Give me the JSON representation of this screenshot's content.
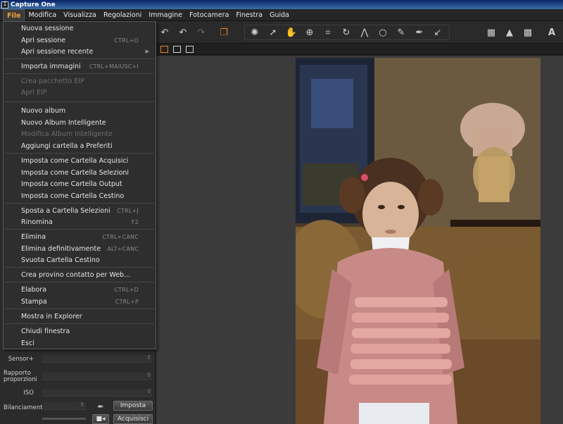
{
  "window": {
    "title": "Capture One"
  },
  "menubar": [
    "File",
    "Modifica",
    "Visualizza",
    "Regolazioni",
    "Immagine",
    "Fotocamera",
    "Finestra",
    "Guida"
  ],
  "file_menu": [
    {
      "label": "Nuova sessione",
      "shortcut": "",
      "enabled": true
    },
    {
      "label": "Apri sessione",
      "shortcut": "CTRL+O",
      "enabled": true
    },
    {
      "label": "Apri sessione recente",
      "shortcut": "",
      "enabled": true,
      "submenu": true
    },
    {
      "label": "Importa immagini",
      "shortcut": "CTRL+MAIUSC+I",
      "enabled": true
    },
    {
      "label": "Crea pacchetto EIP",
      "shortcut": "",
      "enabled": false
    },
    {
      "label": "Apri EIP",
      "shortcut": "",
      "enabled": false
    },
    {
      "label": "Nuovo album",
      "shortcut": "",
      "enabled": true
    },
    {
      "label": "Nuovo Album Intelligente",
      "shortcut": "",
      "enabled": true
    },
    {
      "label": "Modifica Album Intelligente",
      "shortcut": "",
      "enabled": false
    },
    {
      "label": "Aggiungi cartella a Preferiti",
      "shortcut": "",
      "enabled": true
    },
    {
      "label": "Imposta come Cartella Acquisici",
      "shortcut": "",
      "enabled": true
    },
    {
      "label": "Imposta come Cartella Selezioni",
      "shortcut": "",
      "enabled": true
    },
    {
      "label": "Imposta come Cartella Output",
      "shortcut": "",
      "enabled": true
    },
    {
      "label": "Imposta come Cartella Cestino",
      "shortcut": "",
      "enabled": true
    },
    {
      "label": "Sposta a Cartella Selezioni",
      "shortcut": "CTRL+J",
      "enabled": true
    },
    {
      "label": "Rinomina",
      "shortcut": "F2",
      "enabled": true
    },
    {
      "label": "Elimina",
      "shortcut": "CTRL+CANC",
      "enabled": true
    },
    {
      "label": "Elimina definitivamente",
      "shortcut": "ALT+CANC",
      "enabled": true
    },
    {
      "label": "Svuota Cartella Cestino",
      "shortcut": "",
      "enabled": true
    },
    {
      "label": "Crea provino contatto per Web...",
      "shortcut": "",
      "enabled": true
    },
    {
      "label": "Elabora",
      "shortcut": "CTRL+D",
      "enabled": true
    },
    {
      "label": "Stampa",
      "shortcut": "CTRL+P",
      "enabled": true
    },
    {
      "label": "Mostra in Explorer",
      "shortcut": "",
      "enabled": true
    },
    {
      "label": "Chiudi finestra",
      "shortcut": "",
      "enabled": true
    },
    {
      "label": "Esci",
      "shortcut": "",
      "enabled": true
    }
  ],
  "left_panel": {
    "sensor_label": "Sensor+",
    "aspect_label": "Rapporto proporzioni",
    "iso_label": "ISO",
    "wb_label": "Bilanciamento",
    "set_button": "Imposta",
    "capture_button": "Acquisisci"
  },
  "colors": {
    "accent": "#e8861c",
    "menu_bg": "#2e2e2e",
    "panel_bg": "#2b2b2b"
  }
}
